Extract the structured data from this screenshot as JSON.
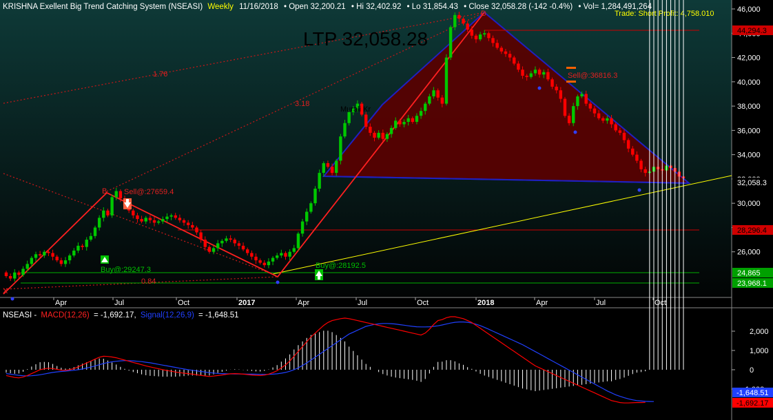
{
  "header": {
    "title": "KRISHNA Exellent Big Trend Catching System (NSEASI)",
    "interval": "Weekly",
    "date": "11/16/2018",
    "open": "• Open 32,200.21",
    "hi": "• Hi 32,402.92",
    "lo": "• Lo 31,854.43",
    "close": "• Close 32,058.28 (-142 -0.4%)",
    "vol": "• Vol= 1,284,491,264",
    "trade": "Trade: Short Profit: 4,758.010"
  },
  "ltp": "LTP 32,058.28",
  "annotations": {
    "fib1": "1.76",
    "fib2": "3.18",
    "fib3": "0.84",
    "murali": "Murali Kr",
    "sell1": "Sell@:27659.4",
    "sell2": "Sell@:36816.3",
    "buy1": "Buy@:29247.3",
    "buy2": "Buy@:28192.5",
    "labelB": "B",
    "labelD": "D",
    "labelX": "X"
  },
  "price_levels": {
    "level_44294": "44,294.3",
    "level_28296": "28,296.4",
    "level_24865": "24,865",
    "level_23968": "23,968.1",
    "last": "32,058.3"
  },
  "macd_header": {
    "symbol": "NSEASI -",
    "macd": "MACD(12,26)",
    "macd_val": "= -1,692.17,",
    "signal": "Signal(12,26,9)",
    "signal_val": "= -1,648.51"
  },
  "macd_tags": {
    "signal": "-1,648.51",
    "macd": "-1,692.17"
  },
  "colors": {
    "up": "#00c800",
    "down": "#ff0000",
    "trendline": "#ffff00",
    "pattern_fill": "#5a0000",
    "pattern_edge": "#2020c0",
    "signal": "#2040ff",
    "macd": "#ff0000",
    "axis_text": "#ffffff"
  },
  "chart_data": [
    {
      "type": "candlestick",
      "title": "KRISHNA Exellent Big Trend Catching System (NSEASI)",
      "x_ticks": [
        "Apr",
        "Jul",
        "Oct",
        "2017",
        "Apr",
        "Jul",
        "Oct",
        "2018",
        "Apr",
        "Jul",
        "Oct"
      ],
      "y_ticks": [
        26000,
        28000,
        30000,
        32000,
        34000,
        36000,
        38000,
        40000,
        42000,
        44000,
        46000
      ],
      "ylim": [
        22700,
        46500
      ],
      "grid": false,
      "series": [
        {
          "name": "close",
          "values": [
            24000,
            23800,
            24300,
            24100,
            24600,
            25000,
            25500,
            25800,
            25700,
            26000,
            25900,
            25600,
            25300,
            25000,
            25300,
            25700,
            26100,
            26500,
            26400,
            27000,
            27300,
            28000,
            28800,
            29400,
            29000,
            30500,
            31000,
            30400,
            29800,
            29400,
            29000,
            28700,
            28500,
            28800,
            28600,
            28400,
            28500,
            28700,
            28900,
            29000,
            28800,
            28600,
            28400,
            28200,
            28000,
            27600,
            27000,
            26400,
            26000,
            26300,
            26700,
            26900,
            27100,
            27000,
            26700,
            26500,
            26200,
            25900,
            25600,
            25300,
            25100,
            24900,
            25200,
            25500,
            25700,
            25900,
            25600,
            26000,
            26300,
            27500,
            28500,
            29300,
            30000,
            31200,
            32500,
            33300,
            33000,
            32500,
            33500,
            35500,
            36600,
            37500,
            37800,
            38200,
            37300,
            36300,
            35800,
            35400,
            35800,
            35300,
            35700,
            36200,
            36800,
            36500,
            36700,
            37000,
            36700,
            37200,
            37600,
            38200,
            38800,
            39300,
            38700,
            38200,
            42000,
            44500,
            45500,
            45200,
            44800,
            44300,
            43800,
            43500,
            43900,
            44000,
            43600,
            43200,
            42800,
            42500,
            42300,
            42000,
            41500,
            41000,
            40500,
            40400,
            40700,
            41000,
            40600,
            40800,
            40200,
            39600,
            39300,
            38600,
            37200,
            36600,
            38000,
            38800,
            39000,
            38200,
            37800,
            37400,
            37000,
            36800,
            37000,
            36500,
            36000,
            35800,
            35200,
            34500,
            34000,
            33500,
            32800,
            32500,
            32600,
            33000,
            32800,
            32700,
            33100,
            32900,
            32600,
            32200,
            32058.28
          ]
        },
        {
          "name": "MACD(12,26)",
          "values": [
            -300,
            -350,
            -400,
            -420,
            -380,
            -300,
            -200,
            -100,
            0,
            50,
            80,
            60,
            20,
            -20,
            -30,
            0,
            60,
            150,
            250,
            350,
            450,
            550,
            650,
            700,
            690,
            660,
            620,
            560,
            500,
            440,
            380,
            320,
            260,
            200,
            150,
            100,
            50,
            0,
            -40,
            -80,
            -120,
            -150,
            -180,
            -200,
            -230,
            -260,
            -290,
            -320,
            -350,
            -330,
            -300,
            -270,
            -240,
            -210,
            -200,
            -210,
            -230,
            -250,
            -270,
            -290,
            -300,
            -280,
            -230,
            -150,
            -50,
            100,
            250,
            450,
            700,
            950,
            1200,
            1450,
            1700,
            1900,
            2100,
            2300,
            2450,
            2550,
            2600,
            2650,
            2680,
            2650,
            2600,
            2550,
            2500,
            2450,
            2400,
            2350,
            2300,
            2250,
            2200,
            2150,
            2100,
            2050,
            2000,
            1950,
            1900,
            1850,
            1800,
            1900,
            2100,
            2350,
            2550,
            2600,
            2700,
            2750,
            2750,
            2700,
            2650,
            2550,
            2450,
            2300,
            2150,
            2000,
            1850,
            1700,
            1550,
            1400,
            1250,
            1100,
            950,
            800,
            650,
            500,
            350,
            200,
            100,
            0,
            -100,
            -200,
            -300,
            -400,
            -500,
            -600,
            -700,
            -800,
            -900,
            -1000,
            -1100,
            -1200,
            -1300,
            -1400,
            -1500,
            -1600,
            -1650,
            -1700,
            -1720,
            -1720,
            -1710,
            -1700,
            -1700,
            -1692.17
          ]
        },
        {
          "name": "Signal(12,26,9)",
          "values": [
            -200,
            -230,
            -260,
            -290,
            -310,
            -320,
            -310,
            -290,
            -260,
            -220,
            -180,
            -140,
            -110,
            -90,
            -70,
            -50,
            -30,
            0,
            40,
            90,
            140,
            200,
            260,
            320,
            370,
            410,
            440,
            460,
            470,
            470,
            460,
            440,
            420,
            390,
            360,
            320,
            280,
            240,
            200,
            160,
            120,
            80,
            40,
            0,
            -30,
            -60,
            -90,
            -120,
            -150,
            -170,
            -190,
            -200,
            -210,
            -215,
            -218,
            -220,
            -222,
            -224,
            -228,
            -232,
            -238,
            -242,
            -240,
            -230,
            -210,
            -180,
            -140,
            -80,
            0,
            100,
            220,
            350,
            500,
            650,
            800,
            950,
            1100,
            1250,
            1400,
            1550,
            1700,
            1850,
            1950,
            2050,
            2150,
            2250,
            2300,
            2350,
            2380,
            2400,
            2400,
            2390,
            2370,
            2340,
            2310,
            2280,
            2250,
            2230,
            2220,
            2220,
            2230,
            2250,
            2280,
            2320,
            2370,
            2420,
            2460,
            2480,
            2480,
            2460,
            2420,
            2360,
            2290,
            2200,
            2100,
            2000,
            1900,
            1800,
            1700,
            1600,
            1500,
            1400,
            1300,
            1180,
            1060,
            940,
            820,
            700,
            580,
            460,
            340,
            220,
            100,
            -20,
            -140,
            -260,
            -380,
            -500,
            -620,
            -740,
            -860,
            -980,
            -1100,
            -1200,
            -1300,
            -1380,
            -1450,
            -1510,
            -1560,
            -1600,
            -1620,
            -1640,
            -1645,
            -1648.51
          ]
        }
      ]
    },
    {
      "type": "line",
      "title": "NSEASI - MACD(12,26) = -1,692.17, Signal(12,26,9) = -1,648.51",
      "y_ticks": [
        -1000,
        0,
        1000,
        2000
      ],
      "ylim": [
        -2600,
        3300
      ]
    }
  ]
}
